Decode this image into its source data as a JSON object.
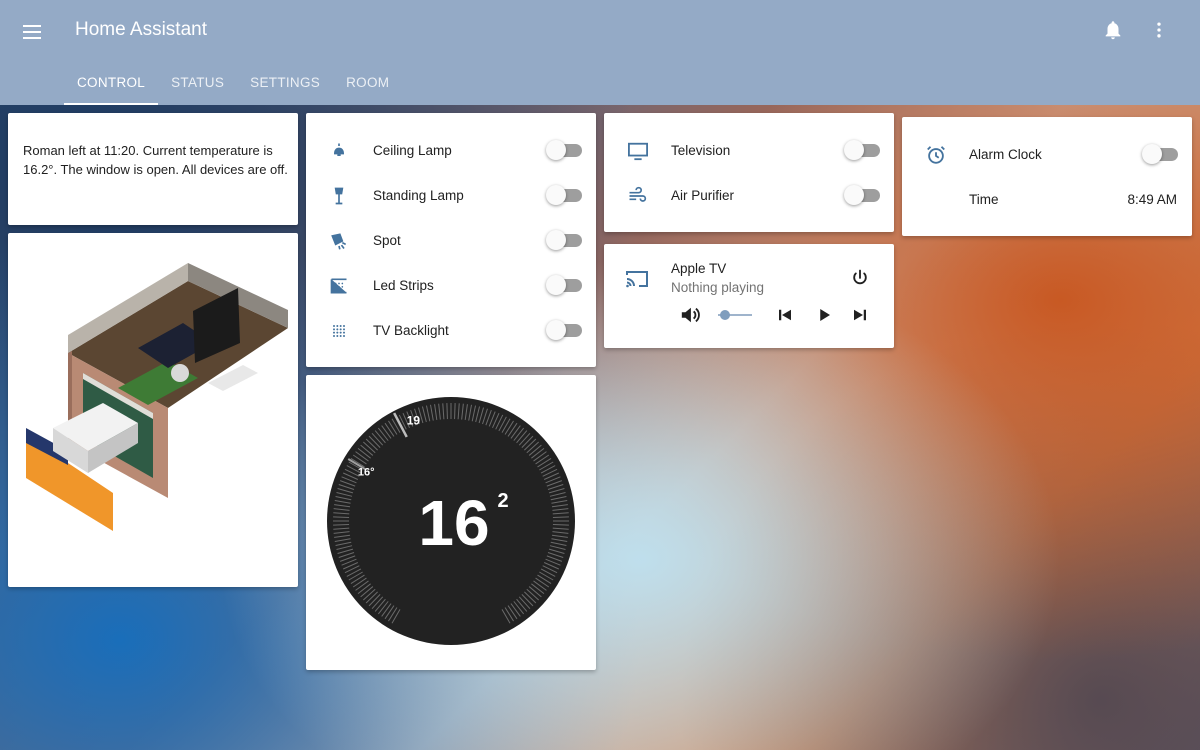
{
  "app": {
    "title": "Home Assistant"
  },
  "header": {
    "menu_icon": "menu-icon",
    "notifications_icon": "bell-icon",
    "overflow_icon": "more-vert-icon"
  },
  "tabs": [
    {
      "label": "CONTROL",
      "active": true
    },
    {
      "label": "STATUS",
      "active": false
    },
    {
      "label": "SETTINGS",
      "active": false
    },
    {
      "label": "ROOM",
      "active": false
    }
  ],
  "summary": {
    "text": "Roman left at 11:20. Current temperature is 16.2°. The window is open. All devices are off."
  },
  "floorplan": {
    "icon": "room-3d-render"
  },
  "lights": [
    {
      "label": "Ceiling Lamp",
      "icon": "ceiling-lamp-icon",
      "on": false
    },
    {
      "label": "Standing Lamp",
      "icon": "floor-lamp-icon",
      "on": false
    },
    {
      "label": "Spot",
      "icon": "spotlight-icon",
      "on": false
    },
    {
      "label": "Led Strips",
      "icon": "led-strip-icon",
      "on": false
    },
    {
      "label": "TV Backlight",
      "icon": "dots-grid-icon",
      "on": false
    }
  ],
  "devices": [
    {
      "label": "Television",
      "icon": "tv-icon",
      "on": false
    },
    {
      "label": "Air Purifier",
      "icon": "air-purifier-icon",
      "on": false
    }
  ],
  "media": {
    "name": "Apple TV",
    "status": "Nothing playing",
    "volume_level": 0.05
  },
  "alarm": {
    "label": "Alarm Clock",
    "on": false,
    "time_label": "Time",
    "time_value": "8:49 AM"
  },
  "thermostat": {
    "current_whole": "16",
    "current_decimal": "2",
    "target_label": "19",
    "current_marker_label": "16°",
    "target": 19,
    "current": 16.2
  },
  "colors": {
    "header": "#94aac6",
    "icon": "#44739e",
    "dial": "#222222"
  }
}
